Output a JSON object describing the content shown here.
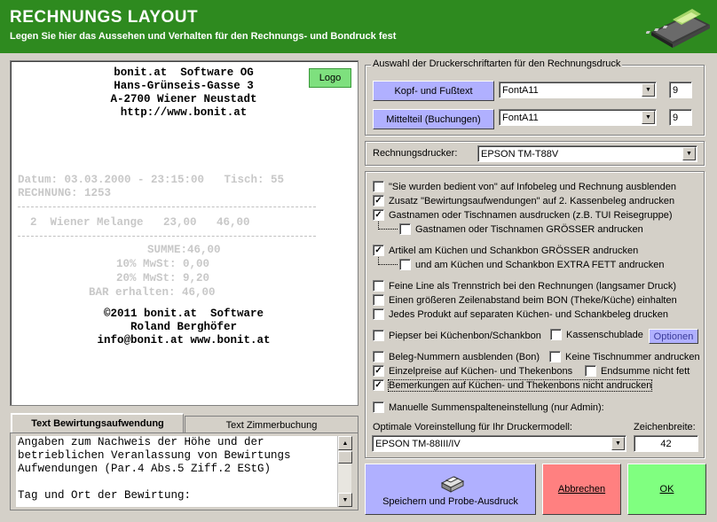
{
  "header": {
    "title": "RECHNUNGS LAYOUT",
    "subtitle": "Legen Sie hier das Aussehen und Verhalten für den Rechnungs- und Bondruck fest"
  },
  "preview": {
    "logo_button": "Logo",
    "company_lines": [
      "bonit.at  Software OG",
      "Hans-Grünseis-Gasse 3",
      "A-2700 Wiener Neustadt",
      "http://www.bonit.at"
    ],
    "datum_line": "Datum: 03.03.2000 - 23:15:00   Tisch: 55",
    "rechnung_line": "RECHNUNG: 1253",
    "item_line": "2  Wiener Melange   23,00   46,00",
    "summe_line": "SUMME:46,00",
    "mwst10_line": "10% MwSt: 0,00",
    "mwst20_line": "20% MwSt: 9,20",
    "bar_line": "BAR erhalten: 46,00",
    "footer_lines": [
      "©2011 bonit.at  Software",
      "Roland Berghöfer",
      "info@bonit.at www.bonit.at"
    ]
  },
  "tabs": {
    "bewirtung": "Text Bewirtungsaufwendung",
    "zimmer": "Text Zimmerbuchung"
  },
  "bewirtung_text": "Angaben zum Nachweis der Höhe und der\nbetrieblichen Veranlassung von Bewirtungs\nAufwendungen (Par.4 Abs.5 Ziff.2 EStG)\n\nTag und Ort der Bewirtung:",
  "fonts_group": {
    "title": "Auswahl der Druckerschriftarten für den Rechnungsdruck",
    "kopf_button": "Kopf- und Fußtext",
    "kopf_font": "FontA11",
    "kopf_size": "9",
    "mittel_button": "Mittelteil (Buchungen)",
    "mittel_font": "FontA11",
    "mittel_size": "9"
  },
  "printer": {
    "label": "Rechnungsdrucker:",
    "value": "EPSON TM-T88V"
  },
  "options": {
    "o1": "\"Sie wurden bedient von\" auf Infobeleg und Rechnung ausblenden",
    "o2": "Zusatz \"Bewirtungsaufwendungen\" auf 2. Kassenbeleg andrucken",
    "o3": "Gastnamen oder Tischnamen ausdrucken (z.B. TUI Reisegruppe)",
    "o4": "Gastnamen oder Tischnamen GRÖSSER andrucken",
    "o5": "Artikel am Küchen und Schankbon GRÖSSER andrucken",
    "o6": "und am Küchen und Schankbon EXTRA FETT andrucken",
    "o7": "Feine Line als Trennstrich bei den Rechnungen (langsamer Druck)",
    "o8": "Einen größeren Zeilenabstand beim BON (Theke/Küche) einhalten",
    "o9": "Jedes Produkt auf separaten Küchen- und Schankbeleg drucken",
    "o10": "Piepser bei Küchenbon/Schankbon",
    "o11": "Kassenschublade",
    "optionen_button": "Optionen",
    "o12": "Beleg-Nummern ausblenden (Bon)",
    "o13": "Keine Tischnummer andrucken",
    "o14": "Einzelpreise auf Küchen- und Thekenbons",
    "o15": "Endsumme nicht fett",
    "o16": "Bemerkungen auf Küchen- und Thekenbons nicht andrucken",
    "o17": "Manuelle Summenspalteneinstellung (nur Admin):",
    "model_label": "Optimale Voreinstellung für Ihr Druckermodell:",
    "model_value": "EPSON TM-88III/IV",
    "width_label": "Zeichenbreite:",
    "width_value": "42",
    "checked": [
      "o2",
      "o3",
      "o5",
      "o14",
      "o16"
    ]
  },
  "buttons": {
    "save": "Speichern und Probe-Ausdruck",
    "cancel": "Abbrechen",
    "ok": "OK"
  },
  "colors": {
    "header_green": "#2e8a1f",
    "save_bg": "#b0b0ff",
    "cancel_bg": "#ff8080",
    "ok_bg": "#80ff80"
  }
}
